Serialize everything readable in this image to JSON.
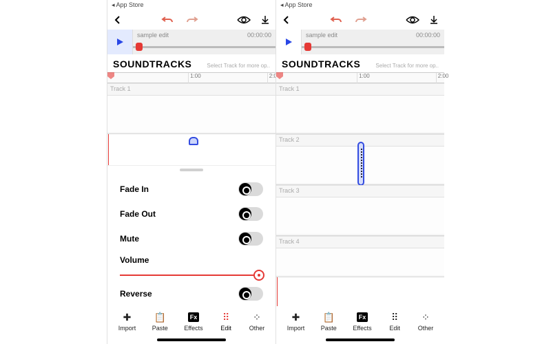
{
  "status_back": "App Store",
  "player": {
    "name": "sample edit",
    "time": "00:00:00"
  },
  "section_title": "SOUNDTRACKS",
  "section_hint": "Select Track for more op..",
  "ruler": {
    "t1": "1:00",
    "t2": "2:00"
  },
  "tracks": {
    "t1": "Track 1",
    "t2": "Track 2",
    "t3": "Track 3",
    "t4": "Track 4"
  },
  "options": {
    "fade_in": "Fade In",
    "fade_out": "Fade Out",
    "mute": "Mute",
    "volume": "Volume",
    "reverse": "Reverse"
  },
  "tabs": {
    "import": "Import",
    "paste": "Paste",
    "effects": "Effects",
    "edit": "Edit",
    "other": "Other"
  }
}
